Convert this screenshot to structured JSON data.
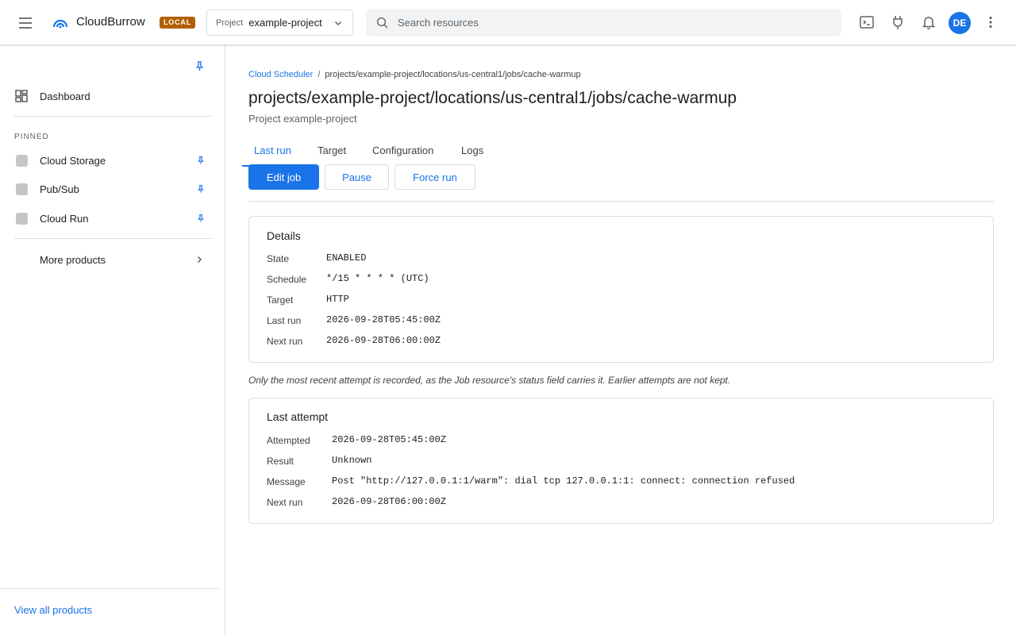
{
  "app": {
    "brand": "CloudBurrow",
    "env_badge": "LOCAL"
  },
  "project_picker": {
    "label": "Project",
    "value": "example-project"
  },
  "search": {
    "placeholder": "Search resources"
  },
  "user": {
    "initials": "DE"
  },
  "sidebar": {
    "dashboard": "Dashboard",
    "pinned_heading": "PINNED",
    "pinned": [
      {
        "label": "Cloud Storage"
      },
      {
        "label": "Pub/Sub"
      },
      {
        "label": "Cloud Run"
      }
    ],
    "more_products": "More products",
    "view_all": "View all products"
  },
  "breadcrumb": {
    "parent": "Cloud Scheduler",
    "separator": "/",
    "current": "projects/example-project/locations/us-central1/jobs/cache-warmup"
  },
  "page": {
    "title": "projects/example-project/locations/us-central1/jobs/cache-warmup",
    "subtitle": "Project example-project"
  },
  "tabs": [
    {
      "label": "Last run"
    },
    {
      "label": "Target"
    },
    {
      "label": "Configuration"
    },
    {
      "label": "Logs"
    }
  ],
  "actions": {
    "edit": "Edit job",
    "pause": "Pause",
    "force_run": "Force run"
  },
  "details": {
    "heading": "Details",
    "rows": [
      {
        "key": "State",
        "value": "ENABLED"
      },
      {
        "key": "Schedule",
        "value": "*/15 * * * * (UTC)"
      },
      {
        "key": "Target",
        "value": "HTTP"
      },
      {
        "key": "Last run",
        "value": "2026-09-28T05:45:00Z"
      },
      {
        "key": "Next run",
        "value": "2026-09-28T06:00:00Z"
      }
    ]
  },
  "note": "Only the most recent attempt is recorded, as the Job resource's status field carries it. Earlier attempts are not kept.",
  "last_attempt": {
    "heading": "Last attempt",
    "rows": [
      {
        "key": "Attempted",
        "value": "2026-09-28T05:45:00Z"
      },
      {
        "key": "Result",
        "value": "Unknown"
      },
      {
        "key": "Message",
        "value": "Post \"http://127.0.0.1:1/warm\": dial tcp 127.0.0.1:1: connect: connection refused"
      },
      {
        "key": "Next run",
        "value": "2026-09-28T06:00:00Z"
      }
    ]
  },
  "colors": {
    "accent": "#1a73e8",
    "badge": "#b06000",
    "border": "#dadce0"
  },
  "icons": [
    "menu-icon",
    "logo-icon",
    "chevron-down-icon",
    "search-icon",
    "terminal-icon",
    "plug-icon",
    "bell-icon",
    "kebab-icon",
    "pin-icon",
    "grid-icon",
    "chevron-right-icon"
  ]
}
